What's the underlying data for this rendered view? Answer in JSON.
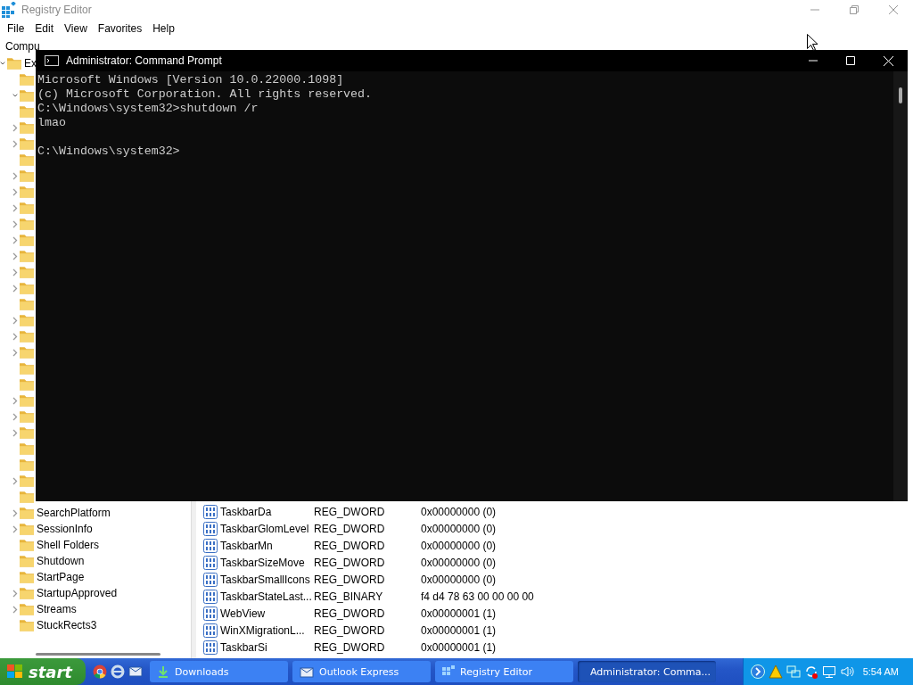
{
  "registry_window": {
    "title": "Registry Editor",
    "menu": [
      "File",
      "Edit",
      "View",
      "Favorites",
      "Help"
    ],
    "address": "Compu",
    "tree": [
      {
        "label": "Ex",
        "expandable": true,
        "expanded": true,
        "children": [
          {
            "expandable": false
          },
          {
            "expandable": true,
            "expanded": true
          },
          {
            "expandable": false
          },
          {
            "expandable": true
          },
          {
            "expandable": true
          },
          {
            "expandable": false
          },
          {
            "expandable": true
          },
          {
            "expandable": true
          },
          {
            "expandable": true
          },
          {
            "expandable": true
          },
          {
            "expandable": true
          },
          {
            "expandable": true
          },
          {
            "expandable": true
          },
          {
            "expandable": true
          },
          {
            "expandable": false
          },
          {
            "expandable": true
          },
          {
            "expandable": true
          },
          {
            "expandable": true
          },
          {
            "expandable": false
          },
          {
            "expandable": false
          },
          {
            "expandable": true
          },
          {
            "expandable": true
          },
          {
            "expandable": true
          },
          {
            "expandable": false
          },
          {
            "expandable": false
          },
          {
            "expandable": true
          },
          {
            "expandable": false
          },
          {
            "label": "SearchPlatform",
            "expandable": true
          },
          {
            "label": "SessionInfo",
            "expandable": true
          },
          {
            "label": "Shell Folders",
            "expandable": false
          },
          {
            "label": "Shutdown",
            "expandable": false
          },
          {
            "label": "StartPage",
            "expandable": false
          },
          {
            "label": "StartupApproved",
            "expandable": true
          },
          {
            "label": "Streams",
            "expandable": true
          },
          {
            "label": "StuckRects3",
            "expandable": false
          }
        ]
      }
    ],
    "values": [
      {
        "name": "TaskbarDa",
        "type": "REG_DWORD",
        "data": "0x00000000 (0)"
      },
      {
        "name": "TaskbarGlomLevel",
        "type": "REG_DWORD",
        "data": "0x00000000 (0)"
      },
      {
        "name": "TaskbarMn",
        "type": "REG_DWORD",
        "data": "0x00000000 (0)"
      },
      {
        "name": "TaskbarSizeMove",
        "type": "REG_DWORD",
        "data": "0x00000000 (0)"
      },
      {
        "name": "TaskbarSmallIcons",
        "type": "REG_DWORD",
        "data": "0x00000000 (0)"
      },
      {
        "name": "TaskbarStateLast...",
        "type": "REG_BINARY",
        "data": "f4 d4 78 63 00 00 00 00"
      },
      {
        "name": "WebView",
        "type": "REG_DWORD",
        "data": "0x00000001 (1)"
      },
      {
        "name": "WinXMigrationL...",
        "type": "REG_DWORD",
        "data": "0x00000001 (1)"
      },
      {
        "name": "TaskbarSi",
        "type": "REG_DWORD",
        "data": "0x00000001 (1)"
      }
    ]
  },
  "cmd_window": {
    "title": "Administrator: Command Prompt",
    "output_blocks": [
      [
        "Microsoft Windows [Version 10.0.22000.1098]",
        "(c) Microsoft Corporation. All rights reserved.",
        "C:\\Windows\\system32>shutdown /r",
        "lmao"
      ],
      [
        "C:\\Windows\\system32>"
      ]
    ]
  },
  "taskbar": {
    "start": "start",
    "tasks": [
      {
        "label": "Downloads",
        "kind": "download",
        "selected": false
      },
      {
        "label": "Outlook Express",
        "kind": "mail",
        "selected": false
      },
      {
        "label": "Registry Editor",
        "kind": "registry",
        "selected": false
      },
      {
        "label": "Administrator: Comma...",
        "kind": "console",
        "selected": true
      }
    ],
    "clock": "5:54 AM"
  }
}
